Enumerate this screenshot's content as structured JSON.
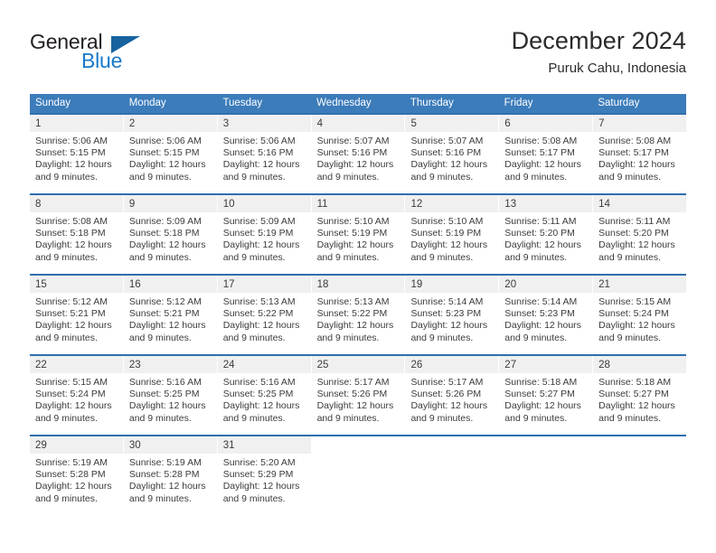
{
  "brand": {
    "name_part1": "General",
    "name_part2": "Blue",
    "triangle_color": "#16639f",
    "blue_color": "#1878c8"
  },
  "header": {
    "title": "December 2024",
    "subtitle": "Puruk Cahu, Indonesia"
  },
  "theme": {
    "header_blue": "#3c7cba",
    "row_rule_blue": "#2f6fae",
    "daynum_band": "#f0f0f0",
    "text": "#3b3b3b"
  },
  "weekdays": [
    "Sunday",
    "Monday",
    "Tuesday",
    "Wednesday",
    "Thursday",
    "Friday",
    "Saturday"
  ],
  "weeks": [
    [
      {
        "day": "1",
        "sunrise": "Sunrise: 5:06 AM",
        "sunset": "Sunset: 5:15 PM",
        "daylight1": "Daylight: 12 hours",
        "daylight2": "and 9 minutes."
      },
      {
        "day": "2",
        "sunrise": "Sunrise: 5:06 AM",
        "sunset": "Sunset: 5:15 PM",
        "daylight1": "Daylight: 12 hours",
        "daylight2": "and 9 minutes."
      },
      {
        "day": "3",
        "sunrise": "Sunrise: 5:06 AM",
        "sunset": "Sunset: 5:16 PM",
        "daylight1": "Daylight: 12 hours",
        "daylight2": "and 9 minutes."
      },
      {
        "day": "4",
        "sunrise": "Sunrise: 5:07 AM",
        "sunset": "Sunset: 5:16 PM",
        "daylight1": "Daylight: 12 hours",
        "daylight2": "and 9 minutes."
      },
      {
        "day": "5",
        "sunrise": "Sunrise: 5:07 AM",
        "sunset": "Sunset: 5:16 PM",
        "daylight1": "Daylight: 12 hours",
        "daylight2": "and 9 minutes."
      },
      {
        "day": "6",
        "sunrise": "Sunrise: 5:08 AM",
        "sunset": "Sunset: 5:17 PM",
        "daylight1": "Daylight: 12 hours",
        "daylight2": "and 9 minutes."
      },
      {
        "day": "7",
        "sunrise": "Sunrise: 5:08 AM",
        "sunset": "Sunset: 5:17 PM",
        "daylight1": "Daylight: 12 hours",
        "daylight2": "and 9 minutes."
      }
    ],
    [
      {
        "day": "8",
        "sunrise": "Sunrise: 5:08 AM",
        "sunset": "Sunset: 5:18 PM",
        "daylight1": "Daylight: 12 hours",
        "daylight2": "and 9 minutes."
      },
      {
        "day": "9",
        "sunrise": "Sunrise: 5:09 AM",
        "sunset": "Sunset: 5:18 PM",
        "daylight1": "Daylight: 12 hours",
        "daylight2": "and 9 minutes."
      },
      {
        "day": "10",
        "sunrise": "Sunrise: 5:09 AM",
        "sunset": "Sunset: 5:19 PM",
        "daylight1": "Daylight: 12 hours",
        "daylight2": "and 9 minutes."
      },
      {
        "day": "11",
        "sunrise": "Sunrise: 5:10 AM",
        "sunset": "Sunset: 5:19 PM",
        "daylight1": "Daylight: 12 hours",
        "daylight2": "and 9 minutes."
      },
      {
        "day": "12",
        "sunrise": "Sunrise: 5:10 AM",
        "sunset": "Sunset: 5:19 PM",
        "daylight1": "Daylight: 12 hours",
        "daylight2": "and 9 minutes."
      },
      {
        "day": "13",
        "sunrise": "Sunrise: 5:11 AM",
        "sunset": "Sunset: 5:20 PM",
        "daylight1": "Daylight: 12 hours",
        "daylight2": "and 9 minutes."
      },
      {
        "day": "14",
        "sunrise": "Sunrise: 5:11 AM",
        "sunset": "Sunset: 5:20 PM",
        "daylight1": "Daylight: 12 hours",
        "daylight2": "and 9 minutes."
      }
    ],
    [
      {
        "day": "15",
        "sunrise": "Sunrise: 5:12 AM",
        "sunset": "Sunset: 5:21 PM",
        "daylight1": "Daylight: 12 hours",
        "daylight2": "and 9 minutes."
      },
      {
        "day": "16",
        "sunrise": "Sunrise: 5:12 AM",
        "sunset": "Sunset: 5:21 PM",
        "daylight1": "Daylight: 12 hours",
        "daylight2": "and 9 minutes."
      },
      {
        "day": "17",
        "sunrise": "Sunrise: 5:13 AM",
        "sunset": "Sunset: 5:22 PM",
        "daylight1": "Daylight: 12 hours",
        "daylight2": "and 9 minutes."
      },
      {
        "day": "18",
        "sunrise": "Sunrise: 5:13 AM",
        "sunset": "Sunset: 5:22 PM",
        "daylight1": "Daylight: 12 hours",
        "daylight2": "and 9 minutes."
      },
      {
        "day": "19",
        "sunrise": "Sunrise: 5:14 AM",
        "sunset": "Sunset: 5:23 PM",
        "daylight1": "Daylight: 12 hours",
        "daylight2": "and 9 minutes."
      },
      {
        "day": "20",
        "sunrise": "Sunrise: 5:14 AM",
        "sunset": "Sunset: 5:23 PM",
        "daylight1": "Daylight: 12 hours",
        "daylight2": "and 9 minutes."
      },
      {
        "day": "21",
        "sunrise": "Sunrise: 5:15 AM",
        "sunset": "Sunset: 5:24 PM",
        "daylight1": "Daylight: 12 hours",
        "daylight2": "and 9 minutes."
      }
    ],
    [
      {
        "day": "22",
        "sunrise": "Sunrise: 5:15 AM",
        "sunset": "Sunset: 5:24 PM",
        "daylight1": "Daylight: 12 hours",
        "daylight2": "and 9 minutes."
      },
      {
        "day": "23",
        "sunrise": "Sunrise: 5:16 AM",
        "sunset": "Sunset: 5:25 PM",
        "daylight1": "Daylight: 12 hours",
        "daylight2": "and 9 minutes."
      },
      {
        "day": "24",
        "sunrise": "Sunrise: 5:16 AM",
        "sunset": "Sunset: 5:25 PM",
        "daylight1": "Daylight: 12 hours",
        "daylight2": "and 9 minutes."
      },
      {
        "day": "25",
        "sunrise": "Sunrise: 5:17 AM",
        "sunset": "Sunset: 5:26 PM",
        "daylight1": "Daylight: 12 hours",
        "daylight2": "and 9 minutes."
      },
      {
        "day": "26",
        "sunrise": "Sunrise: 5:17 AM",
        "sunset": "Sunset: 5:26 PM",
        "daylight1": "Daylight: 12 hours",
        "daylight2": "and 9 minutes."
      },
      {
        "day": "27",
        "sunrise": "Sunrise: 5:18 AM",
        "sunset": "Sunset: 5:27 PM",
        "daylight1": "Daylight: 12 hours",
        "daylight2": "and 9 minutes."
      },
      {
        "day": "28",
        "sunrise": "Sunrise: 5:18 AM",
        "sunset": "Sunset: 5:27 PM",
        "daylight1": "Daylight: 12 hours",
        "daylight2": "and 9 minutes."
      }
    ],
    [
      {
        "day": "29",
        "sunrise": "Sunrise: 5:19 AM",
        "sunset": "Sunset: 5:28 PM",
        "daylight1": "Daylight: 12 hours",
        "daylight2": "and 9 minutes."
      },
      {
        "day": "30",
        "sunrise": "Sunrise: 5:19 AM",
        "sunset": "Sunset: 5:28 PM",
        "daylight1": "Daylight: 12 hours",
        "daylight2": "and 9 minutes."
      },
      {
        "day": "31",
        "sunrise": "Sunrise: 5:20 AM",
        "sunset": "Sunset: 5:29 PM",
        "daylight1": "Daylight: 12 hours",
        "daylight2": "and 9 minutes."
      },
      {
        "day": "",
        "sunrise": "",
        "sunset": "",
        "daylight1": "",
        "daylight2": ""
      },
      {
        "day": "",
        "sunrise": "",
        "sunset": "",
        "daylight1": "",
        "daylight2": ""
      },
      {
        "day": "",
        "sunrise": "",
        "sunset": "",
        "daylight1": "",
        "daylight2": ""
      },
      {
        "day": "",
        "sunrise": "",
        "sunset": "",
        "daylight1": "",
        "daylight2": ""
      }
    ]
  ]
}
